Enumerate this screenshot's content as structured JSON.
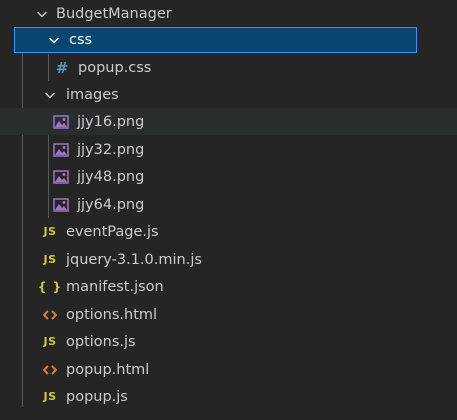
{
  "explorer": {
    "root": {
      "label": "BudgetManager",
      "expanded": true
    },
    "css_folder": {
      "label": "css",
      "expanded": true
    },
    "css_files": [
      {
        "label": "popup.css",
        "icon": "css-file-icon"
      }
    ],
    "images_folder": {
      "label": "images",
      "expanded": true
    },
    "image_files": [
      {
        "label": "jjy16.png",
        "icon": "image-file-icon"
      },
      {
        "label": "jjy32.png",
        "icon": "image-file-icon"
      },
      {
        "label": "jjy48.png",
        "icon": "image-file-icon"
      },
      {
        "label": "jjy64.png",
        "icon": "image-file-icon"
      }
    ],
    "root_files": [
      {
        "label": "eventPage.js",
        "icon": "js-file-icon"
      },
      {
        "label": "jquery-3.1.0.min.js",
        "icon": "js-file-icon"
      },
      {
        "label": "manifest.json",
        "icon": "json-file-icon"
      },
      {
        "label": "options.html",
        "icon": "html-file-icon"
      },
      {
        "label": "options.js",
        "icon": "js-file-icon"
      },
      {
        "label": "popup.html",
        "icon": "html-file-icon"
      },
      {
        "label": "popup.js",
        "icon": "js-file-icon"
      }
    ],
    "icon_glyphs": {
      "js": "JS",
      "json": "{ }",
      "css": "#"
    }
  },
  "colors": {
    "background": "#252526",
    "selection": "#094771",
    "focus_border": "#3794ff",
    "js": "#cbcb41",
    "css": "#519aba",
    "html": "#e37933",
    "image": "#a074c4"
  }
}
